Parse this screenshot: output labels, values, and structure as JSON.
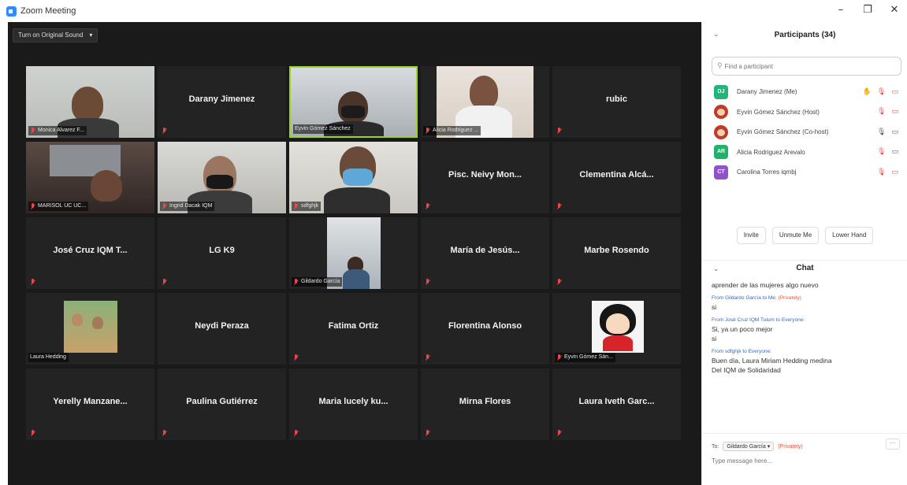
{
  "window": {
    "title": "Zoom Meeting",
    "minimize": "–",
    "maximize": "❐",
    "close": "✕"
  },
  "toolbar": {
    "sound_button": "Turn on Original Sound",
    "sound_arrow": "▾"
  },
  "tiles": [
    {
      "label": "Monica Alvarez F..."
    },
    {
      "name": "Darany Jimenez"
    },
    {
      "label": "Eyvin Gómez Sánchez"
    },
    {
      "label": "Alicia Rodriguez ..."
    },
    {
      "name": "rubic"
    },
    {
      "label": "MARISOL UC UC..."
    },
    {
      "label": "Ingrid Dacak IQM"
    },
    {
      "label": "sdfghjk"
    },
    {
      "name": "Pisc. Neivy Mon..."
    },
    {
      "name": "Clementina Alcá..."
    },
    {
      "name": "José Cruz IQM T..."
    },
    {
      "name": "LG K9"
    },
    {
      "label": "Gildardo García"
    },
    {
      "name": "María de Jesús..."
    },
    {
      "name": "Marbe Rosendo"
    },
    {
      "label": "Laura Hedding"
    },
    {
      "name": "Neydi Peraza"
    },
    {
      "name": "Fatima Ortiz"
    },
    {
      "name": "Florentina Alonso"
    },
    {
      "label": "Eyvin Gómez Sán..."
    },
    {
      "name": "Yerelly Manzane..."
    },
    {
      "name": "Paulina Gutiérrez"
    },
    {
      "name": "Maria lucely ku..."
    },
    {
      "name": "Mirna Flores"
    },
    {
      "name": "Laura Iveth Garc..."
    }
  ],
  "participants": {
    "title": "Participants (34)",
    "search_placeholder": "Find a participant",
    "list": [
      {
        "initials": "DJ",
        "name": "Darany Jimenez (Me)",
        "color": "#26b37a"
      },
      {
        "initials": "",
        "name": "Eyvin Gómez Sánchez (Host)"
      },
      {
        "initials": "",
        "name": "Eyvin Gómez Sánchez (Co-host)"
      },
      {
        "initials": "AR",
        "name": "Alicia Rodriguez Arevalo",
        "color": "#23b06b"
      },
      {
        "initials": "CT",
        "name": "Carolina Torres iqmbj",
        "color": "#8e54c8"
      }
    ],
    "buttons": {
      "invite": "Invite",
      "unmute": "Unmute Me",
      "lower_hand": "Lower Hand"
    }
  },
  "chat": {
    "title": "Chat",
    "first_line": "aprender de las mujeres algo nuevo",
    "messages": [
      {
        "from": "From Gildardo García to Me:",
        "private": "(Privately)",
        "lines": [
          "si"
        ]
      },
      {
        "from": "From José Cruz IQM Tulum to Everyone:",
        "lines": [
          "Si, ya un poco mejor",
          "si"
        ]
      },
      {
        "from": "From sdfghjk to Everyone:",
        "lines": [
          "Buen día, Laura Miriam Hedding medina",
          "Del IQM de Solidaridad"
        ]
      }
    ],
    "to_label": "To:",
    "to_value": "Gildardo García ▾",
    "to_private": "(Privately)",
    "more": "···",
    "input_placeholder": "Type message here..."
  },
  "colors": {
    "accent": "#2d8cff",
    "active_speaker": "#9bd32a",
    "muted": "#e64a4a"
  }
}
